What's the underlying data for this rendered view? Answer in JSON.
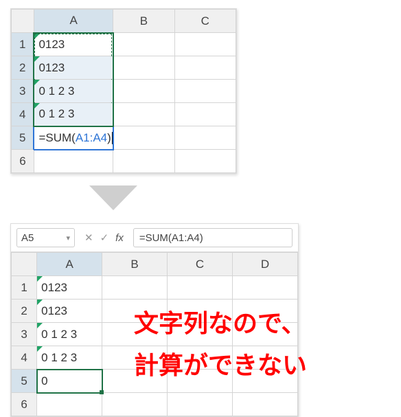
{
  "top": {
    "cols": [
      "A",
      "B",
      "C"
    ],
    "rows": [
      "1",
      "2",
      "3",
      "4",
      "5",
      "6"
    ],
    "a1": "0123",
    "a2": "0123",
    "a3": "0 1 2 3",
    "a4": "0 1 2 3",
    "a5_prefix": "=SUM(",
    "a5_ref": "A1:A4",
    "a5_suffix": ")"
  },
  "bottom": {
    "namebox": "A5",
    "formula": "=SUM(A1:A4)",
    "cols": [
      "A",
      "B",
      "C",
      "D"
    ],
    "rows": [
      "1",
      "2",
      "3",
      "4",
      "5",
      "6"
    ],
    "a1": "0123",
    "a2": "0123",
    "a3": "0 1 2 3",
    "a4": "0 1 2 3",
    "a5": "0"
  },
  "caption": {
    "line1": "文字列なので、",
    "line2": "計算ができない"
  },
  "fx_label": "fx"
}
